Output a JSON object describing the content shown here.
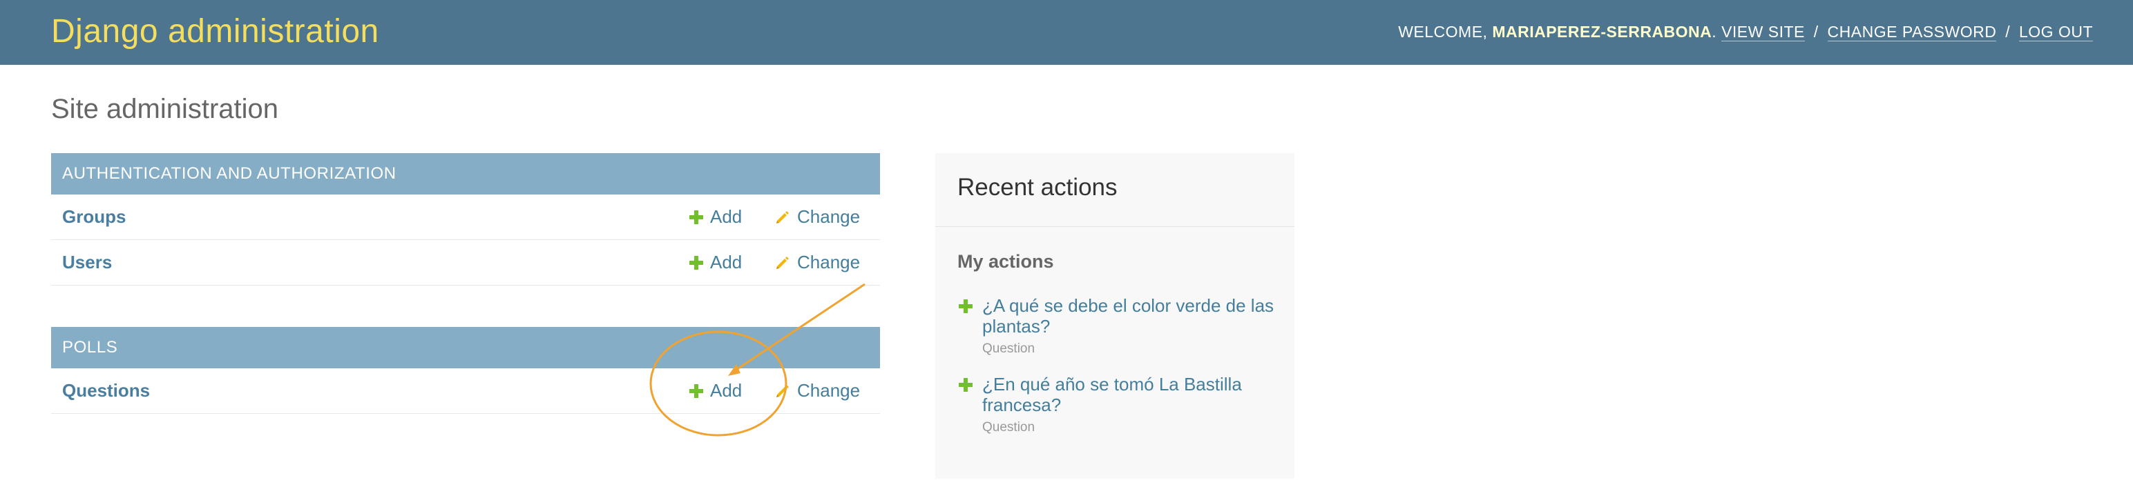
{
  "header": {
    "branding": "Django administration",
    "welcome": "Welcome, ",
    "username": "mariaperez-serrabona",
    "period": ".",
    "view_site": "View site",
    "change_password": "Change password",
    "log_out": "Log out",
    "separator": "/"
  },
  "page": {
    "title": "Site administration"
  },
  "apps": [
    {
      "name": "Authentication and Authorization",
      "models": [
        {
          "name": "Groups",
          "add": "Add",
          "change": "Change"
        },
        {
          "name": "Users",
          "add": "Add",
          "change": "Change"
        }
      ]
    },
    {
      "name": "Polls",
      "models": [
        {
          "name": "Questions",
          "add": "Add",
          "change": "Change"
        }
      ]
    }
  ],
  "recent_actions": {
    "title": "Recent actions",
    "subtitle": "My actions",
    "items": [
      {
        "text": "¿A qué se debe el color verde de las plantas?",
        "type": "Question"
      },
      {
        "text": "¿En qué año se tomó La Bastilla francesa?",
        "type": "Question"
      }
    ]
  },
  "colors": {
    "header_bg": "#4d7590",
    "branding": "#f5dd5d",
    "caption_bg": "#85adc6",
    "link": "#447e9b",
    "add_icon": "#70bf2b",
    "change_icon": "#efb80b",
    "annotation": "#f0a330"
  },
  "icons": {
    "add": "plus-icon",
    "change": "pencil-icon"
  }
}
